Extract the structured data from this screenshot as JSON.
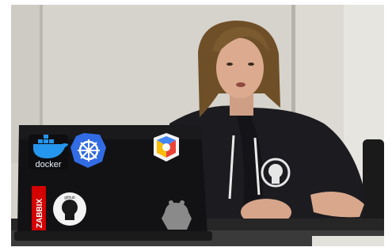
{
  "photo": {
    "description_colors": {
      "wall": "#d6d4cc",
      "hoodie": "#1b1b1f",
      "hair": "#7a5a30",
      "laptop": "#121214",
      "table": "#2a2a2a",
      "skin": "#d8a98e"
    }
  },
  "laptop_stickers": {
    "docker": {
      "text": "docker",
      "color": "#2496ed"
    },
    "kubernetes": {
      "color": "#326ce5"
    },
    "google_cloud": {
      "colors": [
        "#4285f4",
        "#ea4335",
        "#fbbc05",
        "#34a853"
      ]
    },
    "zabbix": {
      "text": "ZABBIX",
      "color": "#d40000"
    },
    "github_octocat": {
      "text": "github"
    },
    "jenkins_silhouette": {
      "color": "#8a8a8a"
    }
  }
}
